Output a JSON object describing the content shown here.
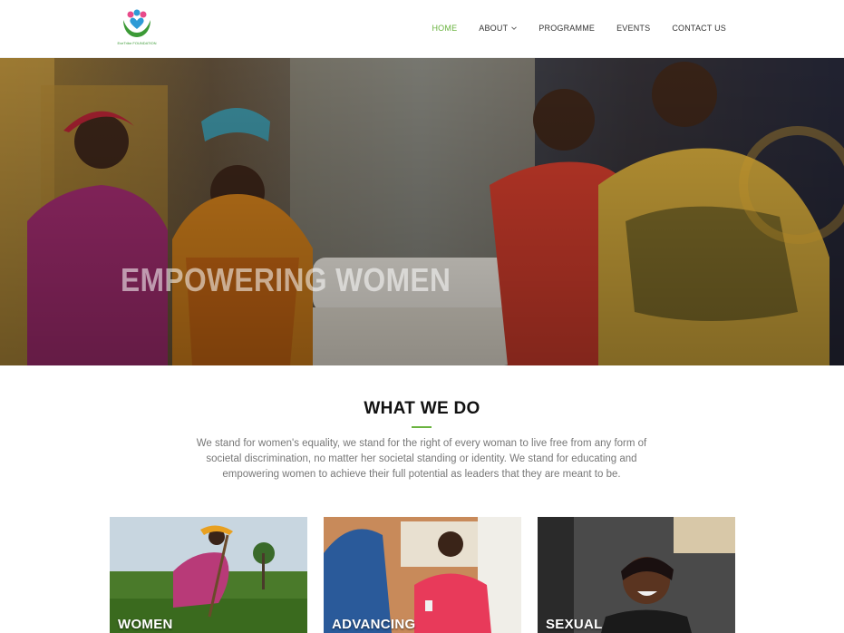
{
  "brand": {
    "logo_text": "EveTribe FOUNDATION"
  },
  "nav": {
    "items": [
      {
        "label": "HOME",
        "active": true
      },
      {
        "label": "ABOUT",
        "has_dropdown": true
      },
      {
        "label": "PROGRAMME"
      },
      {
        "label": "EVENTS"
      },
      {
        "label": "CONTACT US"
      }
    ]
  },
  "hero": {
    "title": "EMPOWERING WOMEN"
  },
  "what_we_do": {
    "title": "WHAT WE DO",
    "text": "We stand for women's equality, we stand for the right of every woman to live free from any form of societal discrimination, no matter her societal standing or identity. We stand for educating and empowering women to achieve their full potential as leaders that they are meant to be."
  },
  "cards": [
    {
      "label": "WOMEN"
    },
    {
      "label": "ADVANCING"
    },
    {
      "label": "SEXUAL"
    }
  ],
  "colors": {
    "accent": "#6ab33f",
    "heading": "#111111",
    "body_text": "#777777"
  }
}
